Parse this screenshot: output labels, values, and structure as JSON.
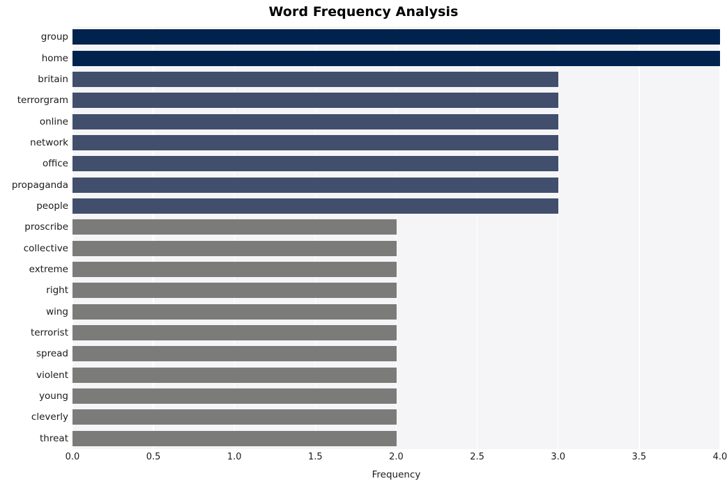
{
  "chart_data": {
    "type": "bar",
    "orientation": "horizontal",
    "title": "Word Frequency Analysis",
    "xlabel": "Frequency",
    "ylabel": "",
    "xlim": [
      0.0,
      4.0
    ],
    "xticks": [
      "0.0",
      "0.5",
      "1.0",
      "1.5",
      "2.0",
      "2.5",
      "3.0",
      "3.5",
      "4.0"
    ],
    "xtick_values": [
      0.0,
      0.5,
      1.0,
      1.5,
      2.0,
      2.5,
      3.0,
      3.5,
      4.0
    ],
    "grid": true,
    "grid_color": "#ffffff",
    "plot_background": "#f5f5f7",
    "legend": null,
    "categories": [
      "group",
      "home",
      "britain",
      "terrorgram",
      "online",
      "network",
      "office",
      "propaganda",
      "people",
      "proscribe",
      "collective",
      "extreme",
      "right",
      "wing",
      "terrorist",
      "spread",
      "violent",
      "young",
      "cleverly",
      "threat"
    ],
    "values": [
      4,
      4,
      3,
      3,
      3,
      3,
      3,
      3,
      3,
      2,
      2,
      2,
      2,
      2,
      2,
      2,
      2,
      2,
      2,
      2
    ],
    "bar_colors": [
      "#00224d",
      "#00224d",
      "#414f6d",
      "#414f6d",
      "#414f6d",
      "#414f6d",
      "#414f6d",
      "#414f6d",
      "#414f6d",
      "#7b7b79",
      "#7b7b79",
      "#7b7b79",
      "#7b7b79",
      "#7b7b79",
      "#7b7b79",
      "#7b7b79",
      "#7b7b79",
      "#7b7b79",
      "#7b7b79",
      "#7b7b79"
    ],
    "palette": {
      "high": "#00224d",
      "medium": "#414f6d",
      "low": "#7b7b79"
    }
  }
}
